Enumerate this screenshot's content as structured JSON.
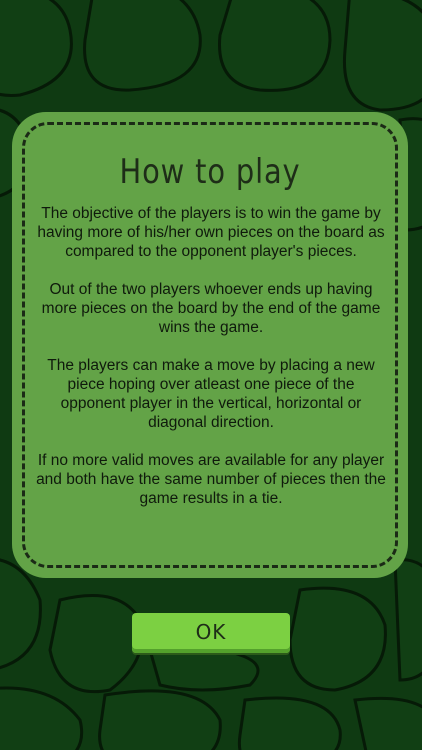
{
  "dialog": {
    "title": "How to play",
    "paragraphs": [
      "The objective of the players is to win the game by having more of his/her own pieces on the board as compared to the opponent player's pieces.",
      "Out of the two players whoever ends up having more pieces on the board by the end of the game wins the game.",
      "The players can make a move by placing a new piece hoping over atleast one piece of the opponent player in the vertical, horizontal or diagonal direction.",
      "If no more valid moves are available for any player and both have the same number of pieces then the game results in a tie."
    ]
  },
  "ok_button": {
    "label": "OK"
  },
  "colors": {
    "background": "#0f3a12",
    "panel": "#63a347",
    "button": "#7cd042"
  }
}
